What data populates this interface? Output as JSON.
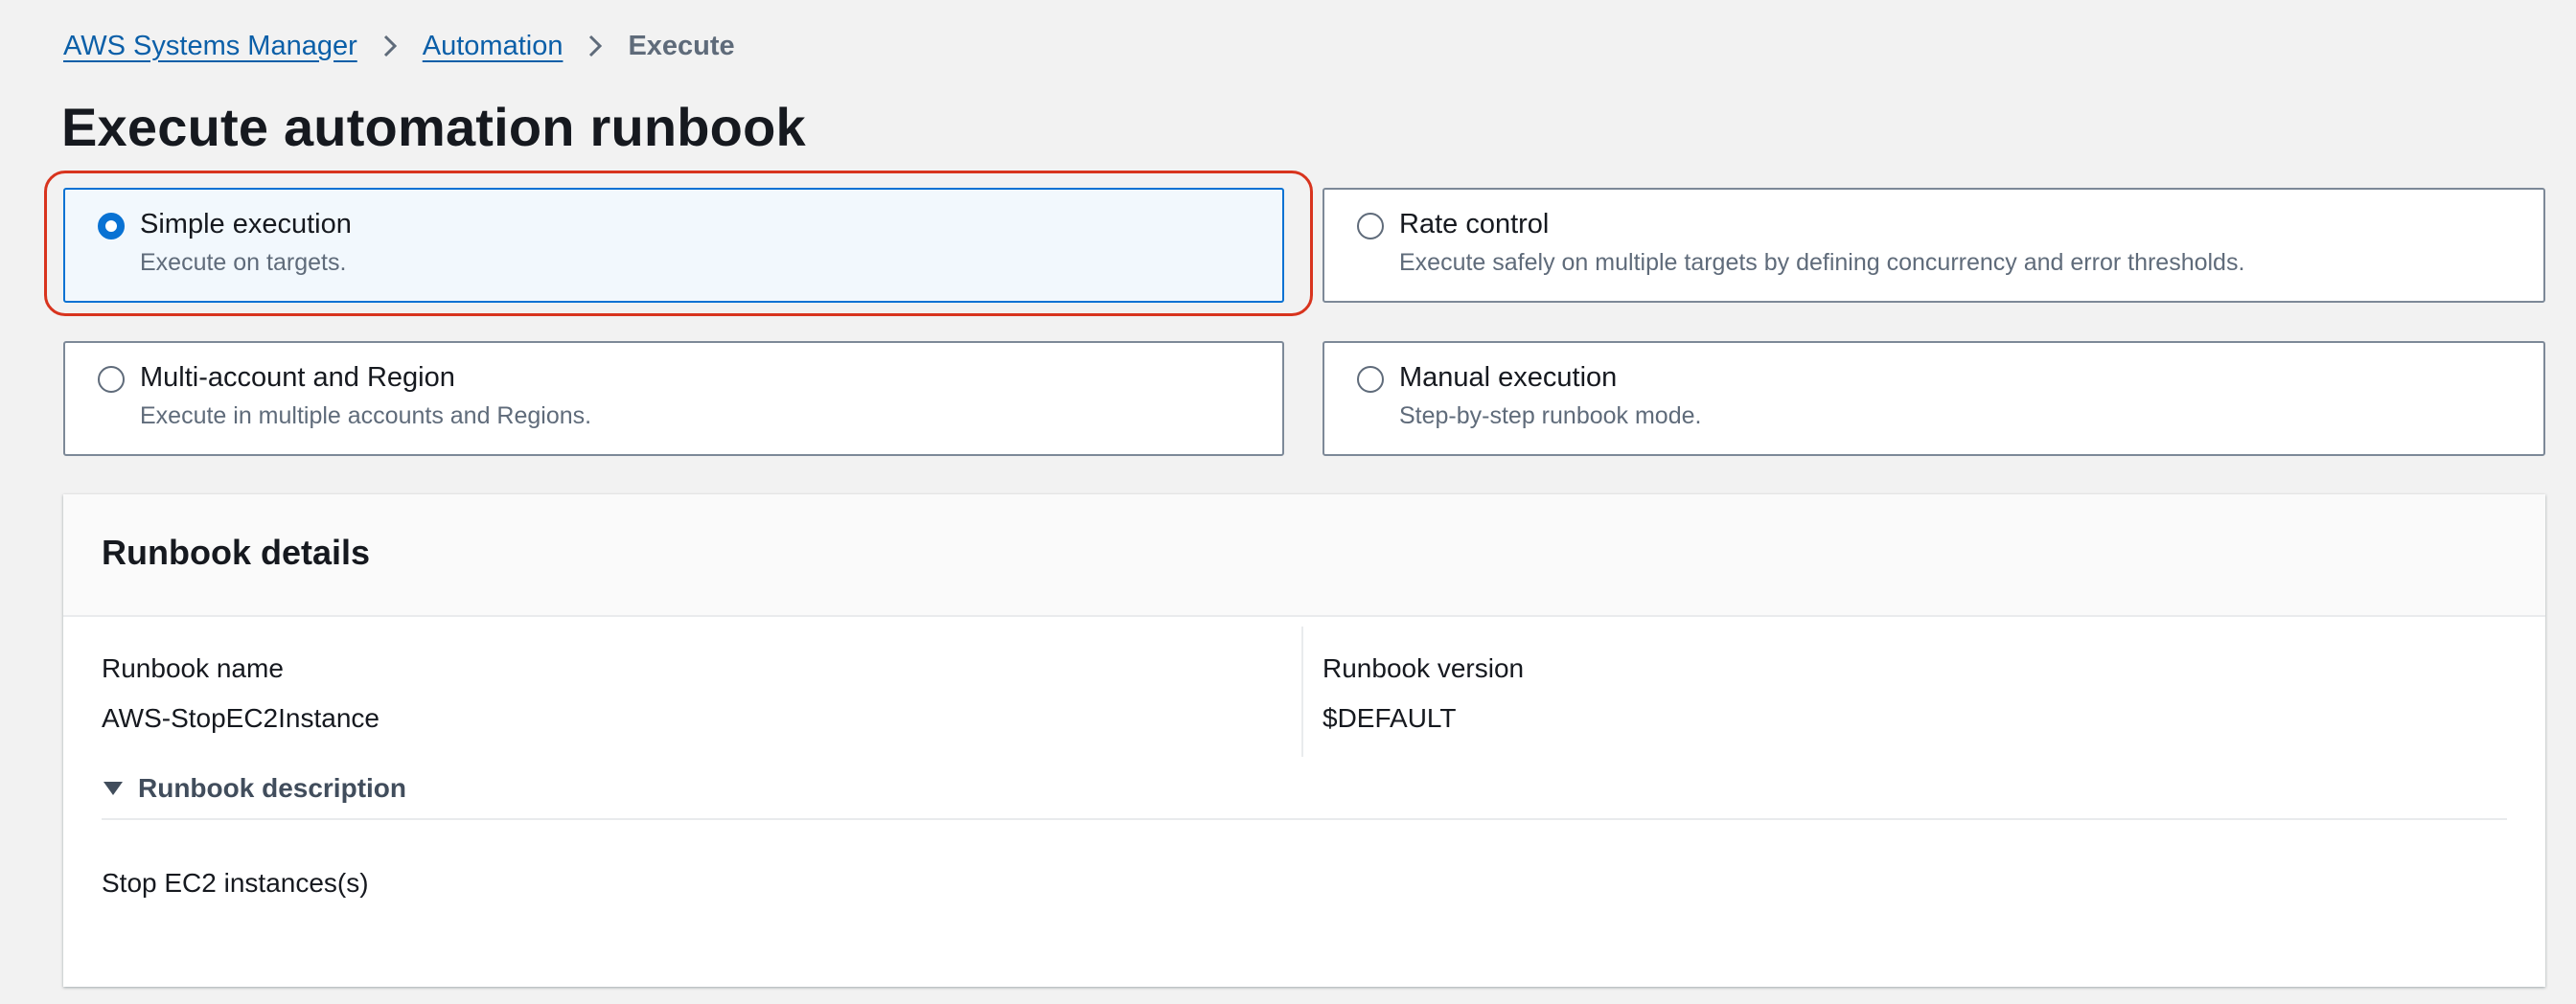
{
  "breadcrumb": {
    "items": [
      "AWS Systems Manager",
      "Automation"
    ],
    "current": "Execute"
  },
  "page_title": "Execute automation runbook",
  "execution_modes": [
    {
      "title": "Simple execution",
      "description": "Execute on targets.",
      "selected": true
    },
    {
      "title": "Rate control",
      "description": "Execute safely on multiple targets by defining concurrency and error thresholds.",
      "selected": false
    },
    {
      "title": "Multi-account and Region",
      "description": "Execute in multiple accounts and Regions.",
      "selected": false
    },
    {
      "title": "Manual execution",
      "description": "Step-by-step runbook mode.",
      "selected": false
    }
  ],
  "runbook_details": {
    "title": "Runbook details",
    "name_label": "Runbook name",
    "name_value": "AWS-StopEC2Instance",
    "version_label": "Runbook version",
    "version_value": "$DEFAULT",
    "description_toggle": "Runbook description",
    "description_text": "Stop EC2 instances(s)"
  },
  "colors": {
    "link": "#0b5fa8",
    "selected_accent": "#0972d3",
    "highlight_outline": "#d8341e",
    "background": "#f2f2f2"
  },
  "icons": {
    "breadcrumb_separator": "chevron-right-icon",
    "expander": "caret-down-icon"
  }
}
